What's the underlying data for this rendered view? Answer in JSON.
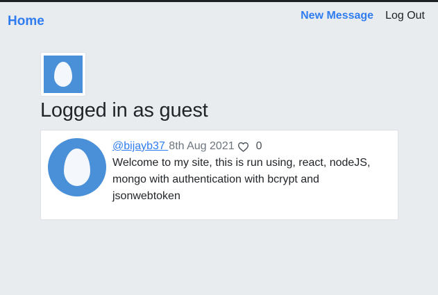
{
  "nav": {
    "brand": "Home",
    "new_message": "New Message",
    "logout": "Log Out"
  },
  "profile": {
    "title": "Logged in as guest",
    "avatar_icon": "egg-icon"
  },
  "messages": [
    {
      "username": "@bijayb37",
      "date": "8th Aug 2021",
      "likes": "0",
      "text": "Welcome to my site, this is run using, react, nodeJS, mongo with authentication with bcrypt and jsonwebtoken",
      "avatar_icon": "egg-icon",
      "like_icon": "heart-icon"
    }
  ],
  "colors": {
    "accent": "#2f7cf0",
    "background": "#e9ecef",
    "avatar_bg": "#4a90d9"
  }
}
